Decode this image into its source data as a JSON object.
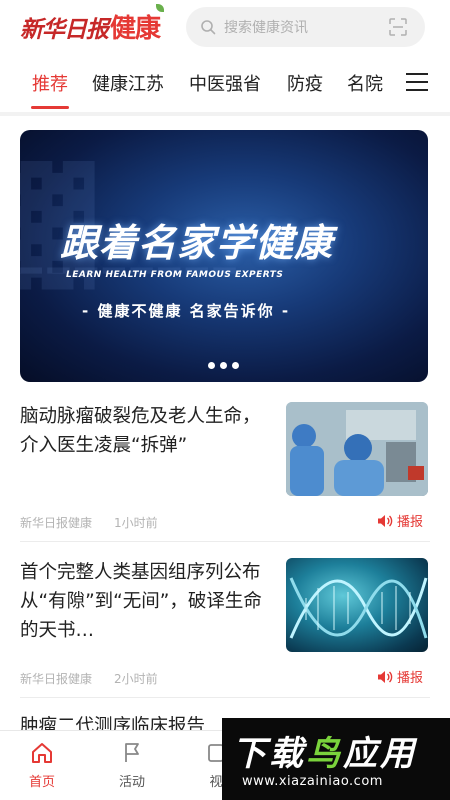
{
  "header": {
    "logo_script": "新华日报",
    "logo_health": "健康",
    "search_placeholder": "搜索健康资讯"
  },
  "tabs": [
    {
      "label": "推荐",
      "active": true
    },
    {
      "label": "健康江苏"
    },
    {
      "label": "中医强省"
    },
    {
      "label": "防疫"
    },
    {
      "label": "名院"
    }
  ],
  "banner": {
    "title": "跟着名家学健康",
    "subtitle": "LEARN HEALTH FROM FAMOUS EXPERTS",
    "slogan": "- 健康不健康  名家告诉你 -",
    "slide_count": 3
  },
  "news": [
    {
      "title": "脑动脉瘤破裂危及老人生命，介入医生凌晨“拆弹”",
      "source": "新华日报健康",
      "time": "1小时前",
      "listen_label": "播报",
      "thumb": "surgery-photo"
    },
    {
      "title": "首个完整人类基因组序列公布 从“有隙”到“无间”，破译生命的天书…",
      "source": "新华日报健康",
      "time": "2小时前",
      "listen_label": "播报",
      "thumb": "dna-helix"
    },
    {
      "title": "肿瘤二代测序临床报告"
    }
  ],
  "bottom_nav": [
    {
      "label": "首页",
      "icon": "home-icon",
      "active": true
    },
    {
      "label": "活动",
      "icon": "flag-icon"
    },
    {
      "label": "视",
      "icon": "video-icon"
    }
  ],
  "watermark": {
    "brand_white": "下载",
    "brand_green": "鸟",
    "brand_white2": "应用",
    "url": "www.xiazainiao.com"
  },
  "colors": {
    "accent": "#e53935",
    "text": "#222222",
    "meta": "#b3b3b3"
  }
}
